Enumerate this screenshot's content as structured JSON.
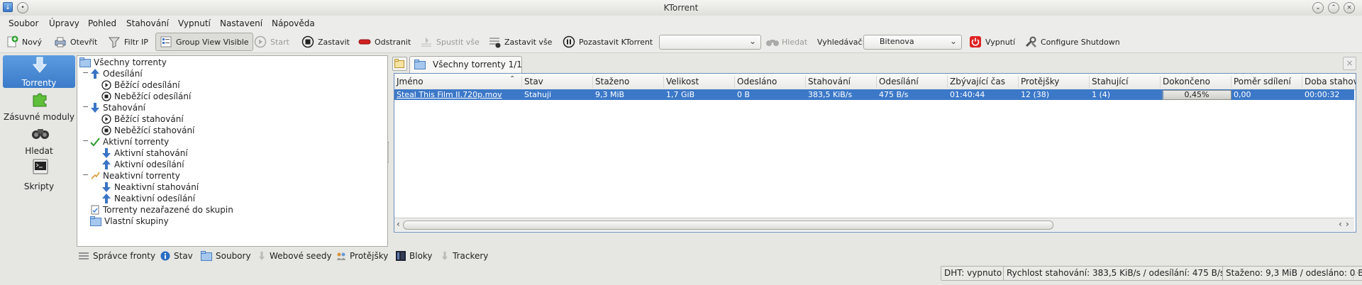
{
  "window": {
    "title": "KTorrent"
  },
  "menu": [
    "Soubor",
    "Úpravy",
    "Pohled",
    "Stahování",
    "Vypnutí",
    "Nastavení",
    "Nápověda"
  ],
  "toolbar": {
    "new": "Nový",
    "open": "Otevřít",
    "filter": "Filtr IP",
    "group_view": "Group View Visible",
    "start": "Start",
    "stop": "Zastavit",
    "remove": "Odstranit",
    "start_all": "Spustit vše",
    "stop_all": "Zastavit vše",
    "pause": "Pozastavit KTorrent",
    "search_value": "",
    "search": "Hledat",
    "engine_label": "Vyhledávač:",
    "engine_value": "Bitenova",
    "shutdown": "Vypnutí",
    "configure_shutdown": "Configure Shutdown"
  },
  "sidebar": {
    "items": [
      {
        "label": "Torrenty",
        "icon": "download-arrow-icon",
        "active": true
      },
      {
        "label": "Zásuvné moduly",
        "icon": "puzzle-icon",
        "active": false
      },
      {
        "label": "Hledat",
        "icon": "binoculars-icon",
        "active": false
      },
      {
        "label": "Skripty",
        "icon": "terminal-icon",
        "active": false
      }
    ]
  },
  "tree": {
    "root": "Všechny torrenty",
    "uploads": "Odesílání",
    "running_uploads": "Běžící odesílání",
    "stopped_uploads": "Neběžící odesílání",
    "downloads": "Stahování",
    "running_downloads": "Běžící stahování",
    "stopped_downloads": "Neběžící stahování",
    "active": "Aktivní torrenty",
    "active_downloads": "Aktivní stahování",
    "active_uploads": "Aktivní odesílání",
    "inactive": "Neaktivní torrenty",
    "inactive_downloads": "Neaktivní stahování",
    "inactive_uploads": "Neaktivní odesílání",
    "ungrouped": "Torrenty nezařazené do skupin",
    "custom": "Vlastní skupiny"
  },
  "tab": {
    "label": "Všechny torrenty 1/1"
  },
  "table": {
    "headers": [
      "Jméno",
      "Stav",
      "Staženo",
      "Velikost",
      "Odesláno",
      "Stahování",
      "Odesílání",
      "Zbývající čas",
      "Protějšky",
      "Stahující",
      "Dokončeno",
      "Poměr sdílení",
      "Doba stahov"
    ],
    "rows": [
      {
        "name": "Steal This Film II.720p.mov",
        "status": "Stahuji",
        "downloaded": "9,3 MiB",
        "size": "1,7 GiB",
        "uploaded": "0 B",
        "down_speed": "383,5 KiB/s",
        "up_speed": "475 B/s",
        "eta": "01:40:44",
        "peers": "12 (38)",
        "seeders": "1 (4)",
        "done_text": "0,45%",
        "done": 0.0045,
        "ratio": "0,00",
        "time": "00:00:32"
      }
    ]
  },
  "bottom_tabs": [
    "Správce fronty",
    "Stav",
    "Soubory",
    "Webové seedy",
    "Protějšky",
    "Bloky",
    "Trackery"
  ],
  "status": {
    "dht": "DHT: vypnuto",
    "speed": "Rychlost stahování: 383,5 KiB/s / odesílání: 475 B/s",
    "totals": "Staženo: 9,3 MiB / odesláno: 0 B"
  },
  "colors": {
    "selection": "#3c78c8",
    "accent": "#4a8ad6",
    "stop_red": "#d22"
  }
}
